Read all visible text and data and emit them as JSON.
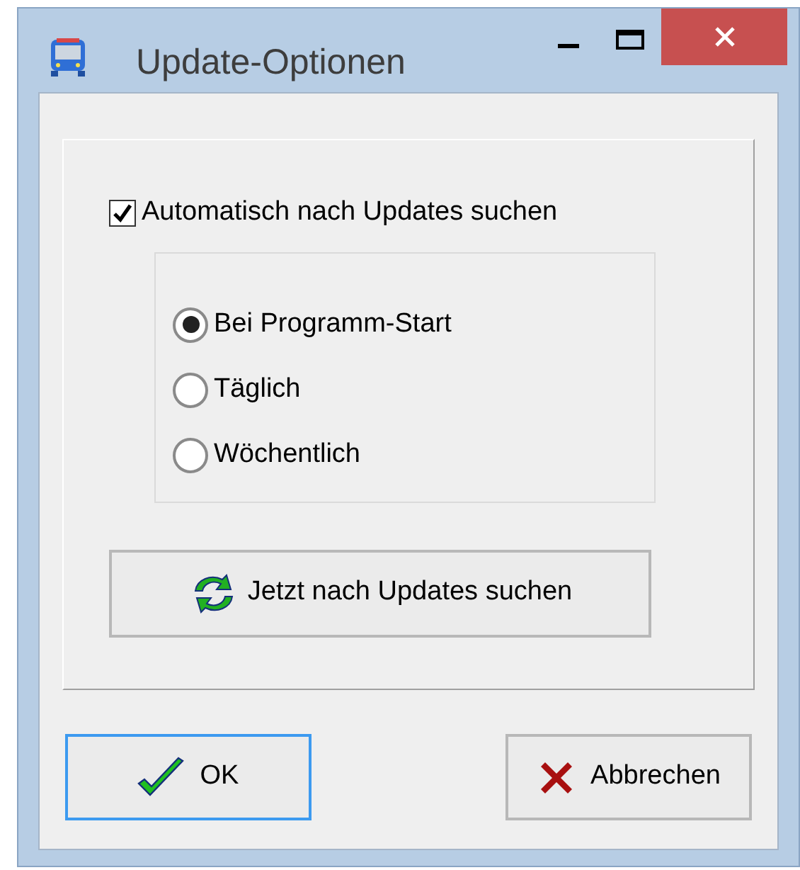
{
  "window": {
    "title": "Update-Optionen"
  },
  "auto_check": {
    "label": "Automatisch nach Updates suchen",
    "checked": true
  },
  "schedule": [
    {
      "label": "Bei Programm-Start",
      "selected": true
    },
    {
      "label": "Täglich",
      "selected": false
    },
    {
      "label": "Wöchentlich",
      "selected": false
    }
  ],
  "check_now_button": "Jetzt nach Updates suchen",
  "buttons": [
    {
      "kind": "ok",
      "label": "OK",
      "focused": true
    },
    {
      "kind": "cancel",
      "label": "Abbrechen",
      "focused": false
    }
  ]
}
